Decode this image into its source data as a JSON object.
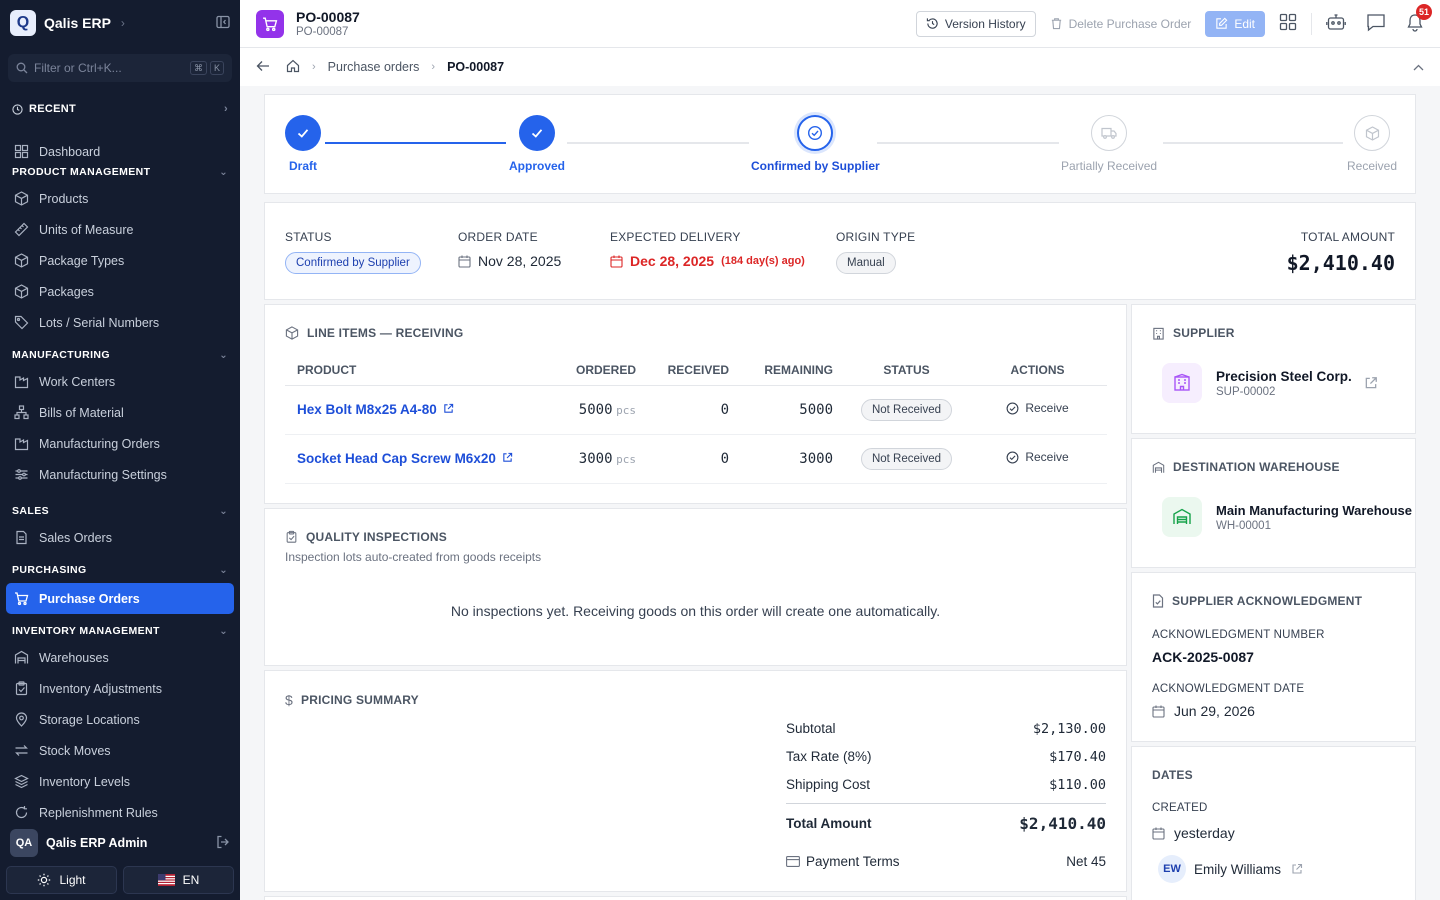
{
  "app": {
    "logo_letter": "Q",
    "name": "Qalis ERP"
  },
  "sidebar": {
    "filter_placeholder": "Filter or Ctrl+K...",
    "kbd": [
      "⌘",
      "K"
    ],
    "recent_label": "RECENT",
    "dashboard": "Dashboard",
    "sections": {
      "product": "PRODUCT MANAGEMENT",
      "manufacturing": "MANUFACTURING",
      "sales": "SALES",
      "purchasing": "PURCHASING",
      "inventory": "INVENTORY MANAGEMENT"
    },
    "product_items": [
      "Products",
      "Units of Measure",
      "Package Types",
      "Packages",
      "Lots / Serial Numbers"
    ],
    "manufacturing_items": [
      "Work Centers",
      "Bills of Material",
      "Manufacturing Orders",
      "Manufacturing Settings"
    ],
    "sales_items": [
      "Sales Orders"
    ],
    "purchasing_items": [
      "Purchase Orders"
    ],
    "inventory_items": [
      "Warehouses",
      "Inventory Adjustments",
      "Storage Locations",
      "Stock Moves",
      "Inventory Levels",
      "Replenishment Rules"
    ],
    "user": {
      "initials": "QA",
      "name": "Qalis ERP Admin"
    },
    "theme_label": "Light",
    "lang_label": "EN"
  },
  "header": {
    "title": "PO-00087",
    "subtitle": "PO-00087",
    "version_history": "Version History",
    "delete": "Delete Purchase Order",
    "edit": "Edit",
    "notif_count": "51"
  },
  "breadcrumb": {
    "parent": "Purchase orders",
    "current": "PO-00087"
  },
  "stepper": {
    "steps": [
      {
        "label": "Draft",
        "state": "done"
      },
      {
        "label": "Approved",
        "state": "done"
      },
      {
        "label": "Confirmed by Supplier",
        "state": "current"
      },
      {
        "label": "Partially Received",
        "state": "todo"
      },
      {
        "label": "Received",
        "state": "todo"
      }
    ]
  },
  "summary": {
    "status_label": "STATUS",
    "status_value": "Confirmed by Supplier",
    "order_date_label": "ORDER DATE",
    "order_date": "Nov 28, 2025",
    "expected_label": "EXPECTED DELIVERY",
    "expected_date": "Dec 28, 2025",
    "expected_note": "(184 day(s) ago)",
    "origin_label": "ORIGIN TYPE",
    "origin_value": "Manual",
    "total_label": "TOTAL AMOUNT",
    "total_value": "$2,410.40"
  },
  "line_items": {
    "title": "LINE ITEMS — RECEIVING",
    "columns": [
      "PRODUCT",
      "ORDERED",
      "RECEIVED",
      "REMAINING",
      "STATUS",
      "ACTIONS"
    ],
    "rows": [
      {
        "product": "Hex Bolt M8x25 A4-80",
        "ordered": "5000",
        "unit": "pcs",
        "received": "0",
        "remaining": "5000",
        "status": "Not Received",
        "action": "Receive"
      },
      {
        "product": "Socket Head Cap Screw M6x20",
        "ordered": "3000",
        "unit": "pcs",
        "received": "0",
        "remaining": "3000",
        "status": "Not Received",
        "action": "Receive"
      }
    ]
  },
  "quality": {
    "title": "QUALITY INSPECTIONS",
    "subtitle": "Inspection lots auto-created from goods receipts",
    "empty": "No inspections yet. Receiving goods on this order will create one automatically."
  },
  "pricing": {
    "title": "PRICING SUMMARY",
    "subtotal_label": "Subtotal",
    "subtotal": "$2,130.00",
    "tax_label": "Tax Rate (8%)",
    "tax": "$170.40",
    "shipping_label": "Shipping Cost",
    "shipping": "$110.00",
    "total_label": "Total Amount",
    "total": "$2,410.40",
    "terms_label": "Payment Terms",
    "terms": "Net 45"
  },
  "supplier": {
    "title": "SUPPLIER",
    "name": "Precision Steel Corp.",
    "code": "SUP-00002"
  },
  "warehouse": {
    "title": "DESTINATION WAREHOUSE",
    "name": "Main Manufacturing Warehouse",
    "code": "WH-00001"
  },
  "acknowledgment": {
    "title": "SUPPLIER ACKNOWLEDGMENT",
    "number_label": "ACKNOWLEDGMENT NUMBER",
    "number": "ACK-2025-0087",
    "date_label": "ACKNOWLEDGMENT DATE",
    "date": "Jun 29, 2026"
  },
  "dates": {
    "title": "DATES",
    "created_label": "CREATED",
    "created": "yesterday",
    "creator_initials": "EW",
    "creator_name": "Emily Williams"
  },
  "colors": {
    "primary": "#2563eb",
    "sidebar_bg": "#141c2f",
    "danger": "#dc2626",
    "purple": "#9333ea",
    "green": "#16a34a"
  }
}
